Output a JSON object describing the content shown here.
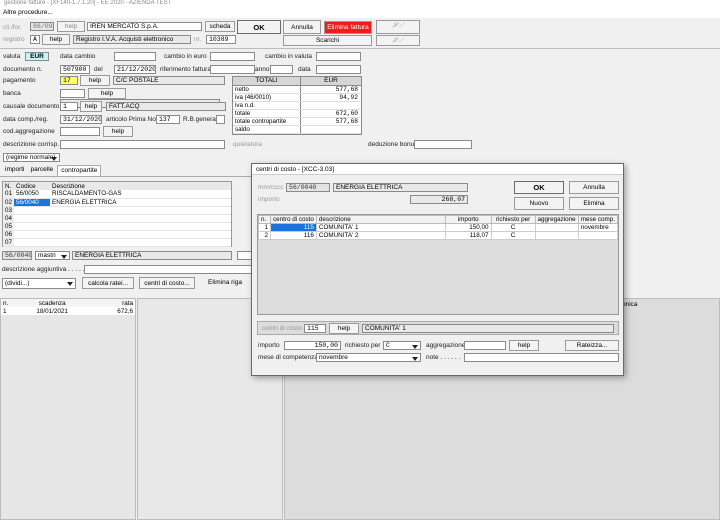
{
  "window": {
    "title": "gestione fatture - [XF140-1.7.1.20] - EE 2020 - AZIENDA TEST",
    "menu": "Altre procedure..."
  },
  "header": {
    "cli_for_label": "cli./for.",
    "cli_for_code": "86/0942",
    "help": "help",
    "cli_for_name": "IREN MERCATO S.p.A.",
    "scheda": "scheda",
    "ok": "OK",
    "annulla": "Annulla",
    "elimina_fattura": "Elimina fattura",
    "scarichi": "Scarichi",
    "registro_label": "registro",
    "registro_code": "A",
    "registro_name": "Registro I.V.A. Acquisti elettronico",
    "nr_label": "nr.",
    "nr_value": "10389",
    "valuta_label": "valuta",
    "valuta_value": "EUR",
    "data_cambio_label": "data cambio",
    "cambio_euro_label": "cambio in euro",
    "cambio_valuta_label": "cambio in valuta",
    "documento_label": "documento n.",
    "documento_value": "507900",
    "del_label": "del",
    "del_value": "21/12/2020",
    "rif_fattura_label": "riferimento fattura",
    "anno_label": "anno",
    "data_label": "data",
    "pagamento_label": "pagamento",
    "pagamento_code": "17",
    "pagamento_desc": "C/C POSTALE",
    "banca_label": "banca",
    "causale_label": "causale documento",
    "causale_code": "1",
    "causale_desc": "FATT.ACQ",
    "data_comp_label": "data comp./reg.",
    "data_comp_value": "31/12/2020",
    "articolo_pn_label": "articolo Prima Nota",
    "articolo_pn_value": "137",
    "rb_generata_label": "R.B.generata",
    "cod_aggr_label": "cod.aggregazione",
    "descr_corrisp_label": "descrizione corrisp.",
    "quietatura_label": "quietatura",
    "deduzione_bonus_label": "deduzione bonus",
    "regime": "(regime normale)"
  },
  "totali": {
    "header_left": "TOTALI",
    "header_right": "EUR",
    "rows": [
      {
        "label": "netto",
        "value": "577,68"
      },
      {
        "label": "iva (46/0010)",
        "value": "94,92"
      },
      {
        "label": "iva n.d.",
        "value": ""
      },
      {
        "label": "totale",
        "value": "672,60"
      },
      {
        "label": "totale contropartite",
        "value": "577,68"
      },
      {
        "label": "saldo",
        "value": ""
      }
    ]
  },
  "tabs": [
    "importi",
    "parcelle",
    "contropartite"
  ],
  "contropartite": {
    "headers": [
      "N.",
      "Codice",
      "Descrizione"
    ],
    "rows": [
      {
        "n": "01",
        "code": "56/0050",
        "desc": "RISCALDAMENTO-GAS"
      },
      {
        "n": "02",
        "code": "56/0040",
        "desc": "ENERGIA ELETTRICA"
      },
      {
        "n": "03",
        "code": "",
        "desc": ""
      },
      {
        "n": "04",
        "code": "",
        "desc": ""
      },
      {
        "n": "05",
        "code": "",
        "desc": ""
      },
      {
        "n": "06",
        "code": "",
        "desc": ""
      },
      {
        "n": "07",
        "code": "",
        "desc": ""
      }
    ],
    "edit_code": "56/0040",
    "mastri": "mastri",
    "edit_desc": "ENERGIA ELETTRICA",
    "descr_agg_label": "descrizione aggiuntiva . . . . . .",
    "dividi": "(dividi...)",
    "calcola_ratei": "calcola ratei...",
    "centri_di_costo": "centri di costo...",
    "elimina_riga": "Elimina riga"
  },
  "scadenze": {
    "headers": [
      "n.",
      "scadenza",
      "rata"
    ],
    "rows": [
      {
        "n": "1",
        "date": "18/01/2021",
        "rate": "672,6"
      }
    ],
    "right_partial_header": "onica"
  },
  "dialog": {
    "title": "centri di costo - [XCC-3.03]",
    "mm_label": "mm/cccc",
    "mm_code": "56/0040",
    "mm_desc": "ENERGIA ELETTRICA",
    "importo_label": "importo",
    "importo_value": "268,07",
    "ok": "OK",
    "annulla": "Annulla",
    "nuovo": "Nuovo",
    "elimina": "Elimina",
    "headers": [
      "n.",
      "centro di costo",
      "descrizione",
      "importo",
      "richiesto per",
      "aggregazione",
      "mese comp."
    ],
    "rows": [
      {
        "n": "1",
        "cc": "115",
        "desc": "COMUNITA' 1",
        "imp": "150,00",
        "rich": "C",
        "aggr": "",
        "mese": "novembre"
      },
      {
        "n": "2",
        "cc": "116",
        "desc": "COMUNITA' 2",
        "imp": "118,07",
        "rich": "C",
        "aggr": "",
        "mese": ""
      }
    ],
    "cc_label": "centri di costo",
    "cc_value": "115",
    "help": "help",
    "cc_desc": "COMUNITA' 1",
    "imp_label": "importo",
    "imp_value": "150,00",
    "rich_label": "richiesto per",
    "rich_value": "C",
    "aggr_label": "aggregazione",
    "aggr_help": "help",
    "rateizza": "Rateizza...",
    "mese_label": "mese di competenza",
    "mese_value": "novembre",
    "note_label": "note . . . . . ."
  }
}
